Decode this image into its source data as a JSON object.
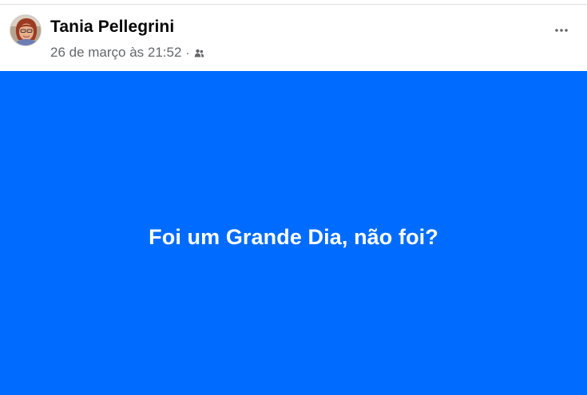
{
  "post": {
    "author_name": "Tania Pellegrini",
    "timestamp": "26 de março às 21:52",
    "separator": "·",
    "audience_icon": "friends-icon",
    "menu_icon": "more-options-icon",
    "text": "Foi um Grande Dia, não foi?",
    "background_color": "#006cff",
    "text_color": "#ffffff"
  }
}
